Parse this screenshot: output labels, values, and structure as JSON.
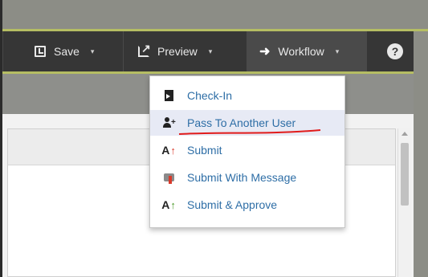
{
  "toolbar": {
    "save_label": "Save",
    "preview_label": "Preview",
    "workflow_label": "Workflow",
    "caret": "▾",
    "help_label": "?"
  },
  "workflow_menu": {
    "items": [
      {
        "label": "Check-In",
        "icon": "check-in-icon"
      },
      {
        "label": "Pass To Another User",
        "icon": "pass-user-icon",
        "highlighted": true
      },
      {
        "label": "Submit",
        "icon": "submit-icon"
      },
      {
        "label": "Submit With Message",
        "icon": "submit-message-icon"
      },
      {
        "label": "Submit & Approve",
        "icon": "submit-approve-icon"
      }
    ]
  },
  "colors": {
    "toolbar_bg": "#363636",
    "accent_green": "#b5bd63",
    "menu_text": "#2e6ea6",
    "annotation_red": "#e11b1b"
  }
}
